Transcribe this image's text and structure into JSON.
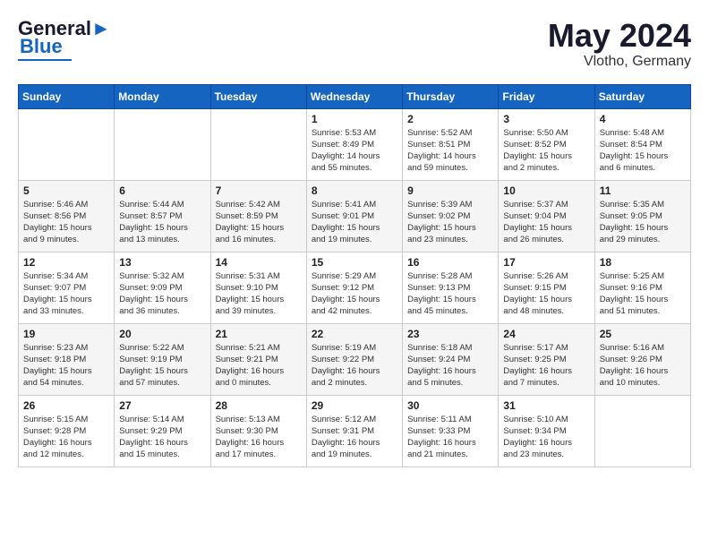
{
  "header": {
    "logo_line1": "General",
    "logo_line2": "Blue",
    "month": "May 2024",
    "location": "Vlotho, Germany"
  },
  "weekdays": [
    "Sunday",
    "Monday",
    "Tuesday",
    "Wednesday",
    "Thursday",
    "Friday",
    "Saturday"
  ],
  "weeks": [
    [
      {
        "day": "",
        "info": ""
      },
      {
        "day": "",
        "info": ""
      },
      {
        "day": "",
        "info": ""
      },
      {
        "day": "1",
        "info": "Sunrise: 5:53 AM\nSunset: 8:49 PM\nDaylight: 14 hours\nand 55 minutes."
      },
      {
        "day": "2",
        "info": "Sunrise: 5:52 AM\nSunset: 8:51 PM\nDaylight: 14 hours\nand 59 minutes."
      },
      {
        "day": "3",
        "info": "Sunrise: 5:50 AM\nSunset: 8:52 PM\nDaylight: 15 hours\nand 2 minutes."
      },
      {
        "day": "4",
        "info": "Sunrise: 5:48 AM\nSunset: 8:54 PM\nDaylight: 15 hours\nand 6 minutes."
      }
    ],
    [
      {
        "day": "5",
        "info": "Sunrise: 5:46 AM\nSunset: 8:56 PM\nDaylight: 15 hours\nand 9 minutes."
      },
      {
        "day": "6",
        "info": "Sunrise: 5:44 AM\nSunset: 8:57 PM\nDaylight: 15 hours\nand 13 minutes."
      },
      {
        "day": "7",
        "info": "Sunrise: 5:42 AM\nSunset: 8:59 PM\nDaylight: 15 hours\nand 16 minutes."
      },
      {
        "day": "8",
        "info": "Sunrise: 5:41 AM\nSunset: 9:01 PM\nDaylight: 15 hours\nand 19 minutes."
      },
      {
        "day": "9",
        "info": "Sunrise: 5:39 AM\nSunset: 9:02 PM\nDaylight: 15 hours\nand 23 minutes."
      },
      {
        "day": "10",
        "info": "Sunrise: 5:37 AM\nSunset: 9:04 PM\nDaylight: 15 hours\nand 26 minutes."
      },
      {
        "day": "11",
        "info": "Sunrise: 5:35 AM\nSunset: 9:05 PM\nDaylight: 15 hours\nand 29 minutes."
      }
    ],
    [
      {
        "day": "12",
        "info": "Sunrise: 5:34 AM\nSunset: 9:07 PM\nDaylight: 15 hours\nand 33 minutes."
      },
      {
        "day": "13",
        "info": "Sunrise: 5:32 AM\nSunset: 9:09 PM\nDaylight: 15 hours\nand 36 minutes."
      },
      {
        "day": "14",
        "info": "Sunrise: 5:31 AM\nSunset: 9:10 PM\nDaylight: 15 hours\nand 39 minutes."
      },
      {
        "day": "15",
        "info": "Sunrise: 5:29 AM\nSunset: 9:12 PM\nDaylight: 15 hours\nand 42 minutes."
      },
      {
        "day": "16",
        "info": "Sunrise: 5:28 AM\nSunset: 9:13 PM\nDaylight: 15 hours\nand 45 minutes."
      },
      {
        "day": "17",
        "info": "Sunrise: 5:26 AM\nSunset: 9:15 PM\nDaylight: 15 hours\nand 48 minutes."
      },
      {
        "day": "18",
        "info": "Sunrise: 5:25 AM\nSunset: 9:16 PM\nDaylight: 15 hours\nand 51 minutes."
      }
    ],
    [
      {
        "day": "19",
        "info": "Sunrise: 5:23 AM\nSunset: 9:18 PM\nDaylight: 15 hours\nand 54 minutes."
      },
      {
        "day": "20",
        "info": "Sunrise: 5:22 AM\nSunset: 9:19 PM\nDaylight: 15 hours\nand 57 minutes."
      },
      {
        "day": "21",
        "info": "Sunrise: 5:21 AM\nSunset: 9:21 PM\nDaylight: 16 hours\nand 0 minutes."
      },
      {
        "day": "22",
        "info": "Sunrise: 5:19 AM\nSunset: 9:22 PM\nDaylight: 16 hours\nand 2 minutes."
      },
      {
        "day": "23",
        "info": "Sunrise: 5:18 AM\nSunset: 9:24 PM\nDaylight: 16 hours\nand 5 minutes."
      },
      {
        "day": "24",
        "info": "Sunrise: 5:17 AM\nSunset: 9:25 PM\nDaylight: 16 hours\nand 7 minutes."
      },
      {
        "day": "25",
        "info": "Sunrise: 5:16 AM\nSunset: 9:26 PM\nDaylight: 16 hours\nand 10 minutes."
      }
    ],
    [
      {
        "day": "26",
        "info": "Sunrise: 5:15 AM\nSunset: 9:28 PM\nDaylight: 16 hours\nand 12 minutes."
      },
      {
        "day": "27",
        "info": "Sunrise: 5:14 AM\nSunset: 9:29 PM\nDaylight: 16 hours\nand 15 minutes."
      },
      {
        "day": "28",
        "info": "Sunrise: 5:13 AM\nSunset: 9:30 PM\nDaylight: 16 hours\nand 17 minutes."
      },
      {
        "day": "29",
        "info": "Sunrise: 5:12 AM\nSunset: 9:31 PM\nDaylight: 16 hours\nand 19 minutes."
      },
      {
        "day": "30",
        "info": "Sunrise: 5:11 AM\nSunset: 9:33 PM\nDaylight: 16 hours\nand 21 minutes."
      },
      {
        "day": "31",
        "info": "Sunrise: 5:10 AM\nSunset: 9:34 PM\nDaylight: 16 hours\nand 23 minutes."
      },
      {
        "day": "",
        "info": ""
      }
    ]
  ]
}
